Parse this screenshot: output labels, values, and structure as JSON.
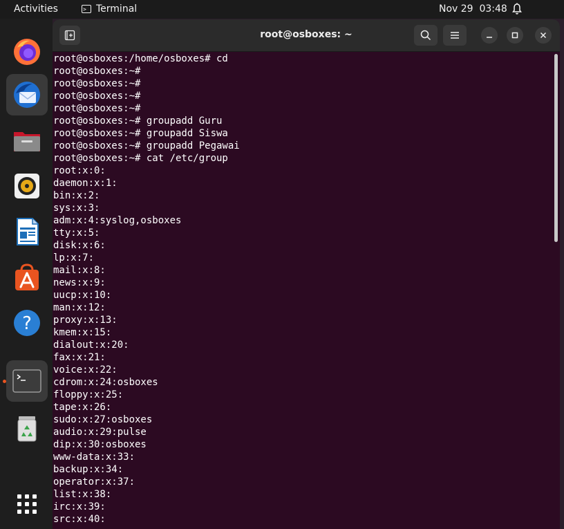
{
  "topbar": {
    "activities": "Activities",
    "app_name": "Terminal",
    "app_icon": "terminal-icon",
    "clock": "Nov 29  03:48",
    "status_icon": "bell-icon"
  },
  "dock": {
    "items": [
      {
        "name": "firefox",
        "icon": "firefox-icon"
      },
      {
        "name": "thunderbird",
        "icon": "thunderbird-icon"
      },
      {
        "name": "files",
        "icon": "folder-icon"
      },
      {
        "name": "rhythmbox",
        "icon": "speaker-icon"
      },
      {
        "name": "writer",
        "icon": "document-icon"
      },
      {
        "name": "software",
        "icon": "app-store-icon"
      },
      {
        "name": "help",
        "icon": "help-icon"
      },
      {
        "name": "terminal",
        "icon": "terminal-icon",
        "running": true
      },
      {
        "name": "trash",
        "icon": "trash-icon"
      },
      {
        "name": "show-apps",
        "icon": "app-grid-icon"
      }
    ]
  },
  "window": {
    "title": "root@osboxes: ~",
    "buttons": [
      "new-tab-icon",
      "search-icon",
      "menu-icon",
      "minimize-icon",
      "maximize-icon",
      "close-icon"
    ]
  },
  "terminal": {
    "lines": [
      "root@osboxes:/home/osboxes# cd",
      "root@osboxes:~#",
      "root@osboxes:~#",
      "root@osboxes:~#",
      "root@osboxes:~#",
      "root@osboxes:~# groupadd Guru",
      "root@osboxes:~# groupadd Siswa",
      "root@osboxes:~# groupadd Pegawai",
      "root@osboxes:~# cat /etc/group",
      "root:x:0:",
      "daemon:x:1:",
      "bin:x:2:",
      "sys:x:3:",
      "adm:x:4:syslog,osboxes",
      "tty:x:5:",
      "disk:x:6:",
      "lp:x:7:",
      "mail:x:8:",
      "news:x:9:",
      "uucp:x:10:",
      "man:x:12:",
      "proxy:x:13:",
      "kmem:x:15:",
      "dialout:x:20:",
      "fax:x:21:",
      "voice:x:22:",
      "cdrom:x:24:osboxes",
      "floppy:x:25:",
      "tape:x:26:",
      "sudo:x:27:osboxes",
      "audio:x:29:pulse",
      "dip:x:30:osboxes",
      "www-data:x:33:",
      "backup:x:34:",
      "operator:x:37:",
      "list:x:38:",
      "irc:x:39:",
      "src:x:40:"
    ]
  },
  "colors": {
    "terminal_bg": "#2c0a22",
    "accent": "#e95420"
  }
}
